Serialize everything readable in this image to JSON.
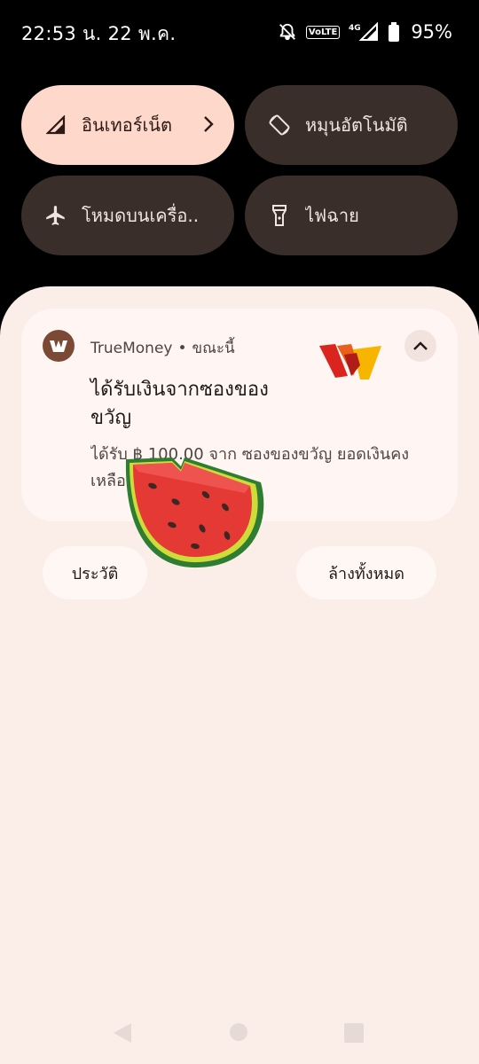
{
  "status_bar": {
    "time_date": "22:53 น. 22 พ.ค.",
    "volte": "VoLTE",
    "network": "4G",
    "battery": "95%",
    "icons": [
      "do-not-disturb-icon",
      "volte-icon",
      "signal-icon",
      "battery-icon"
    ]
  },
  "quick_settings": {
    "tiles": [
      {
        "label": "อินเทอร์เน็ต",
        "icon": "signal-icon",
        "active": true
      },
      {
        "label": "หมุนอัตโนมัติ",
        "icon": "auto-rotate-icon",
        "active": false
      },
      {
        "label": "โหมดบนเครื่อ..",
        "icon": "airplane-icon",
        "active": false
      },
      {
        "label": "ไฟฉาย",
        "icon": "flashlight-icon",
        "active": false
      }
    ]
  },
  "notification": {
    "app_name": "TrueMoney",
    "separator": "•",
    "time": "ขณะนี้",
    "title": "ได้รับเงินจากซองของขวัญ",
    "body": "ได้รับ ฿ 100.00 จาก ซองของขวัญ ยอดเงินคงเหลือ",
    "colors": {
      "app_icon": "#7c4a34",
      "logo_red": "#d9251d",
      "logo_yellow": "#f7b500"
    }
  },
  "actions": {
    "history_label": "ประวัติ",
    "clear_all_label": "ล้างทั้งหมด"
  },
  "overlay": {
    "icon": "watermelon-sticker"
  },
  "colors": {
    "shade_bg": "#fbede8",
    "card_bg": "#fff5f2",
    "tile_active": "#ffd8cc",
    "tile_inactive": "#3a2e2b"
  }
}
